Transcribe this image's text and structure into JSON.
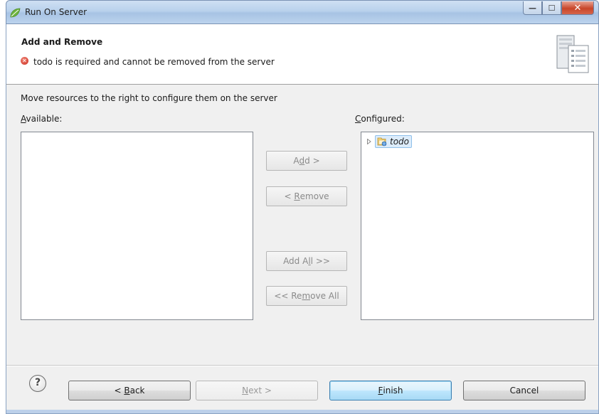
{
  "window": {
    "title": "Run On Server",
    "controls": {
      "minimize": "—",
      "maximize": "☐",
      "close": "✕"
    }
  },
  "header": {
    "title": "Add and Remove",
    "error_message": "todo is required and cannot be removed from the server"
  },
  "main": {
    "description": "Move resources to the right to configure them on the server",
    "available_label": {
      "mnemonic": "A",
      "rest": "vailable:"
    },
    "configured_label": {
      "mnemonic": "C",
      "rest": "onfigured:"
    },
    "configured_items": [
      {
        "label": "todo",
        "icon": "web-project-icon",
        "expanded": false
      }
    ],
    "buttons": {
      "add": {
        "pre": "A",
        "mnemonic": "d",
        "post": "d >"
      },
      "remove": {
        "pre": "< ",
        "mnemonic": "R",
        "post": "emove"
      },
      "add_all": {
        "pre": "Add A",
        "mnemonic": "l",
        "post": "l >>"
      },
      "remove_all": {
        "pre": "<< Re",
        "mnemonic": "m",
        "post": "ove All"
      }
    }
  },
  "footer": {
    "help": "?",
    "back": {
      "pre": "< ",
      "mnemonic": "B",
      "post": "ack"
    },
    "next": {
      "pre": "",
      "mnemonic": "N",
      "post": "ext >"
    },
    "finish": {
      "pre": "",
      "mnemonic": "F",
      "post": "inish"
    },
    "cancel": "Cancel"
  },
  "colors": {
    "titlebar": "#b9d1ec",
    "dialog_bg": "#f0f0f0",
    "selection_bg": "#dcecfb",
    "error_red": "#c9281a",
    "default_button": "#a7d9f5"
  }
}
